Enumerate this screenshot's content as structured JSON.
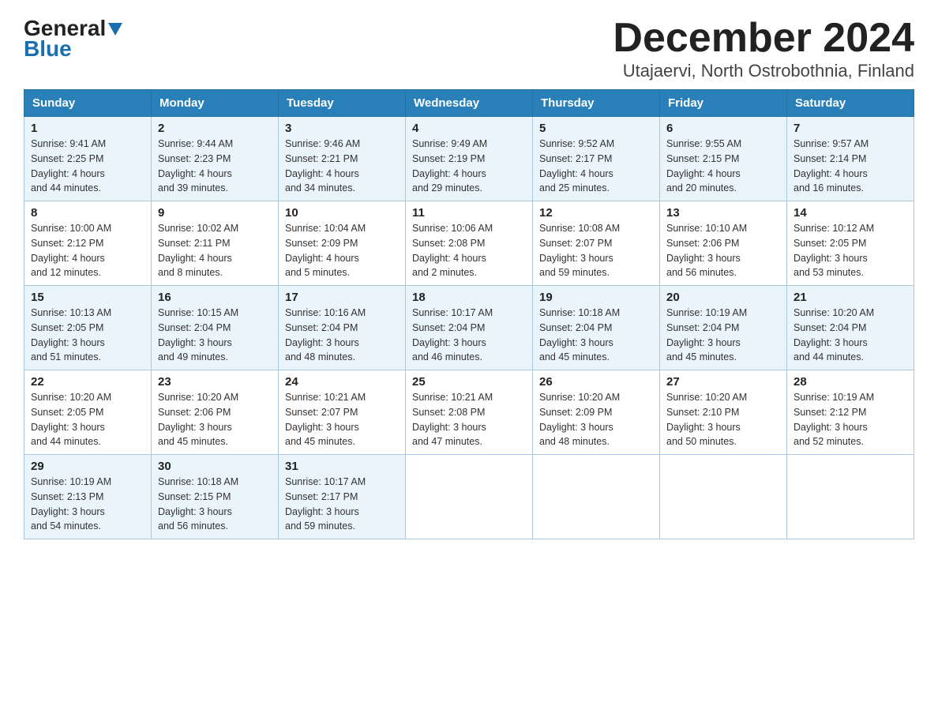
{
  "header": {
    "logo_general": "General",
    "logo_blue": "Blue",
    "title": "December 2024",
    "subtitle": "Utajaervi, North Ostrobothnia, Finland"
  },
  "days_of_week": [
    "Sunday",
    "Monday",
    "Tuesday",
    "Wednesday",
    "Thursday",
    "Friday",
    "Saturday"
  ],
  "weeks": [
    [
      {
        "day": "1",
        "sunrise": "9:41 AM",
        "sunset": "2:25 PM",
        "daylight": "4 hours and 44 minutes."
      },
      {
        "day": "2",
        "sunrise": "9:44 AM",
        "sunset": "2:23 PM",
        "daylight": "4 hours and 39 minutes."
      },
      {
        "day": "3",
        "sunrise": "9:46 AM",
        "sunset": "2:21 PM",
        "daylight": "4 hours and 34 minutes."
      },
      {
        "day": "4",
        "sunrise": "9:49 AM",
        "sunset": "2:19 PM",
        "daylight": "4 hours and 29 minutes."
      },
      {
        "day": "5",
        "sunrise": "9:52 AM",
        "sunset": "2:17 PM",
        "daylight": "4 hours and 25 minutes."
      },
      {
        "day": "6",
        "sunrise": "9:55 AM",
        "sunset": "2:15 PM",
        "daylight": "4 hours and 20 minutes."
      },
      {
        "day": "7",
        "sunrise": "9:57 AM",
        "sunset": "2:14 PM",
        "daylight": "4 hours and 16 minutes."
      }
    ],
    [
      {
        "day": "8",
        "sunrise": "10:00 AM",
        "sunset": "2:12 PM",
        "daylight": "4 hours and 12 minutes."
      },
      {
        "day": "9",
        "sunrise": "10:02 AM",
        "sunset": "2:11 PM",
        "daylight": "4 hours and 8 minutes."
      },
      {
        "day": "10",
        "sunrise": "10:04 AM",
        "sunset": "2:09 PM",
        "daylight": "4 hours and 5 minutes."
      },
      {
        "day": "11",
        "sunrise": "10:06 AM",
        "sunset": "2:08 PM",
        "daylight": "4 hours and 2 minutes."
      },
      {
        "day": "12",
        "sunrise": "10:08 AM",
        "sunset": "2:07 PM",
        "daylight": "3 hours and 59 minutes."
      },
      {
        "day": "13",
        "sunrise": "10:10 AM",
        "sunset": "2:06 PM",
        "daylight": "3 hours and 56 minutes."
      },
      {
        "day": "14",
        "sunrise": "10:12 AM",
        "sunset": "2:05 PM",
        "daylight": "3 hours and 53 minutes."
      }
    ],
    [
      {
        "day": "15",
        "sunrise": "10:13 AM",
        "sunset": "2:05 PM",
        "daylight": "3 hours and 51 minutes."
      },
      {
        "day": "16",
        "sunrise": "10:15 AM",
        "sunset": "2:04 PM",
        "daylight": "3 hours and 49 minutes."
      },
      {
        "day": "17",
        "sunrise": "10:16 AM",
        "sunset": "2:04 PM",
        "daylight": "3 hours and 48 minutes."
      },
      {
        "day": "18",
        "sunrise": "10:17 AM",
        "sunset": "2:04 PM",
        "daylight": "3 hours and 46 minutes."
      },
      {
        "day": "19",
        "sunrise": "10:18 AM",
        "sunset": "2:04 PM",
        "daylight": "3 hours and 45 minutes."
      },
      {
        "day": "20",
        "sunrise": "10:19 AM",
        "sunset": "2:04 PM",
        "daylight": "3 hours and 45 minutes."
      },
      {
        "day": "21",
        "sunrise": "10:20 AM",
        "sunset": "2:04 PM",
        "daylight": "3 hours and 44 minutes."
      }
    ],
    [
      {
        "day": "22",
        "sunrise": "10:20 AM",
        "sunset": "2:05 PM",
        "daylight": "3 hours and 44 minutes."
      },
      {
        "day": "23",
        "sunrise": "10:20 AM",
        "sunset": "2:06 PM",
        "daylight": "3 hours and 45 minutes."
      },
      {
        "day": "24",
        "sunrise": "10:21 AM",
        "sunset": "2:07 PM",
        "daylight": "3 hours and 45 minutes."
      },
      {
        "day": "25",
        "sunrise": "10:21 AM",
        "sunset": "2:08 PM",
        "daylight": "3 hours and 47 minutes."
      },
      {
        "day": "26",
        "sunrise": "10:20 AM",
        "sunset": "2:09 PM",
        "daylight": "3 hours and 48 minutes."
      },
      {
        "day": "27",
        "sunrise": "10:20 AM",
        "sunset": "2:10 PM",
        "daylight": "3 hours and 50 minutes."
      },
      {
        "day": "28",
        "sunrise": "10:19 AM",
        "sunset": "2:12 PM",
        "daylight": "3 hours and 52 minutes."
      }
    ],
    [
      {
        "day": "29",
        "sunrise": "10:19 AM",
        "sunset": "2:13 PM",
        "daylight": "3 hours and 54 minutes."
      },
      {
        "day": "30",
        "sunrise": "10:18 AM",
        "sunset": "2:15 PM",
        "daylight": "3 hours and 56 minutes."
      },
      {
        "day": "31",
        "sunrise": "10:17 AM",
        "sunset": "2:17 PM",
        "daylight": "3 hours and 59 minutes."
      },
      null,
      null,
      null,
      null
    ]
  ],
  "labels": {
    "sunrise": "Sunrise:",
    "sunset": "Sunset:",
    "daylight": "Daylight:"
  },
  "colors": {
    "header_bg": "#2980b9",
    "odd_row": "#eaf4fb",
    "even_row": "#ffffff",
    "border": "#aac8e0"
  }
}
